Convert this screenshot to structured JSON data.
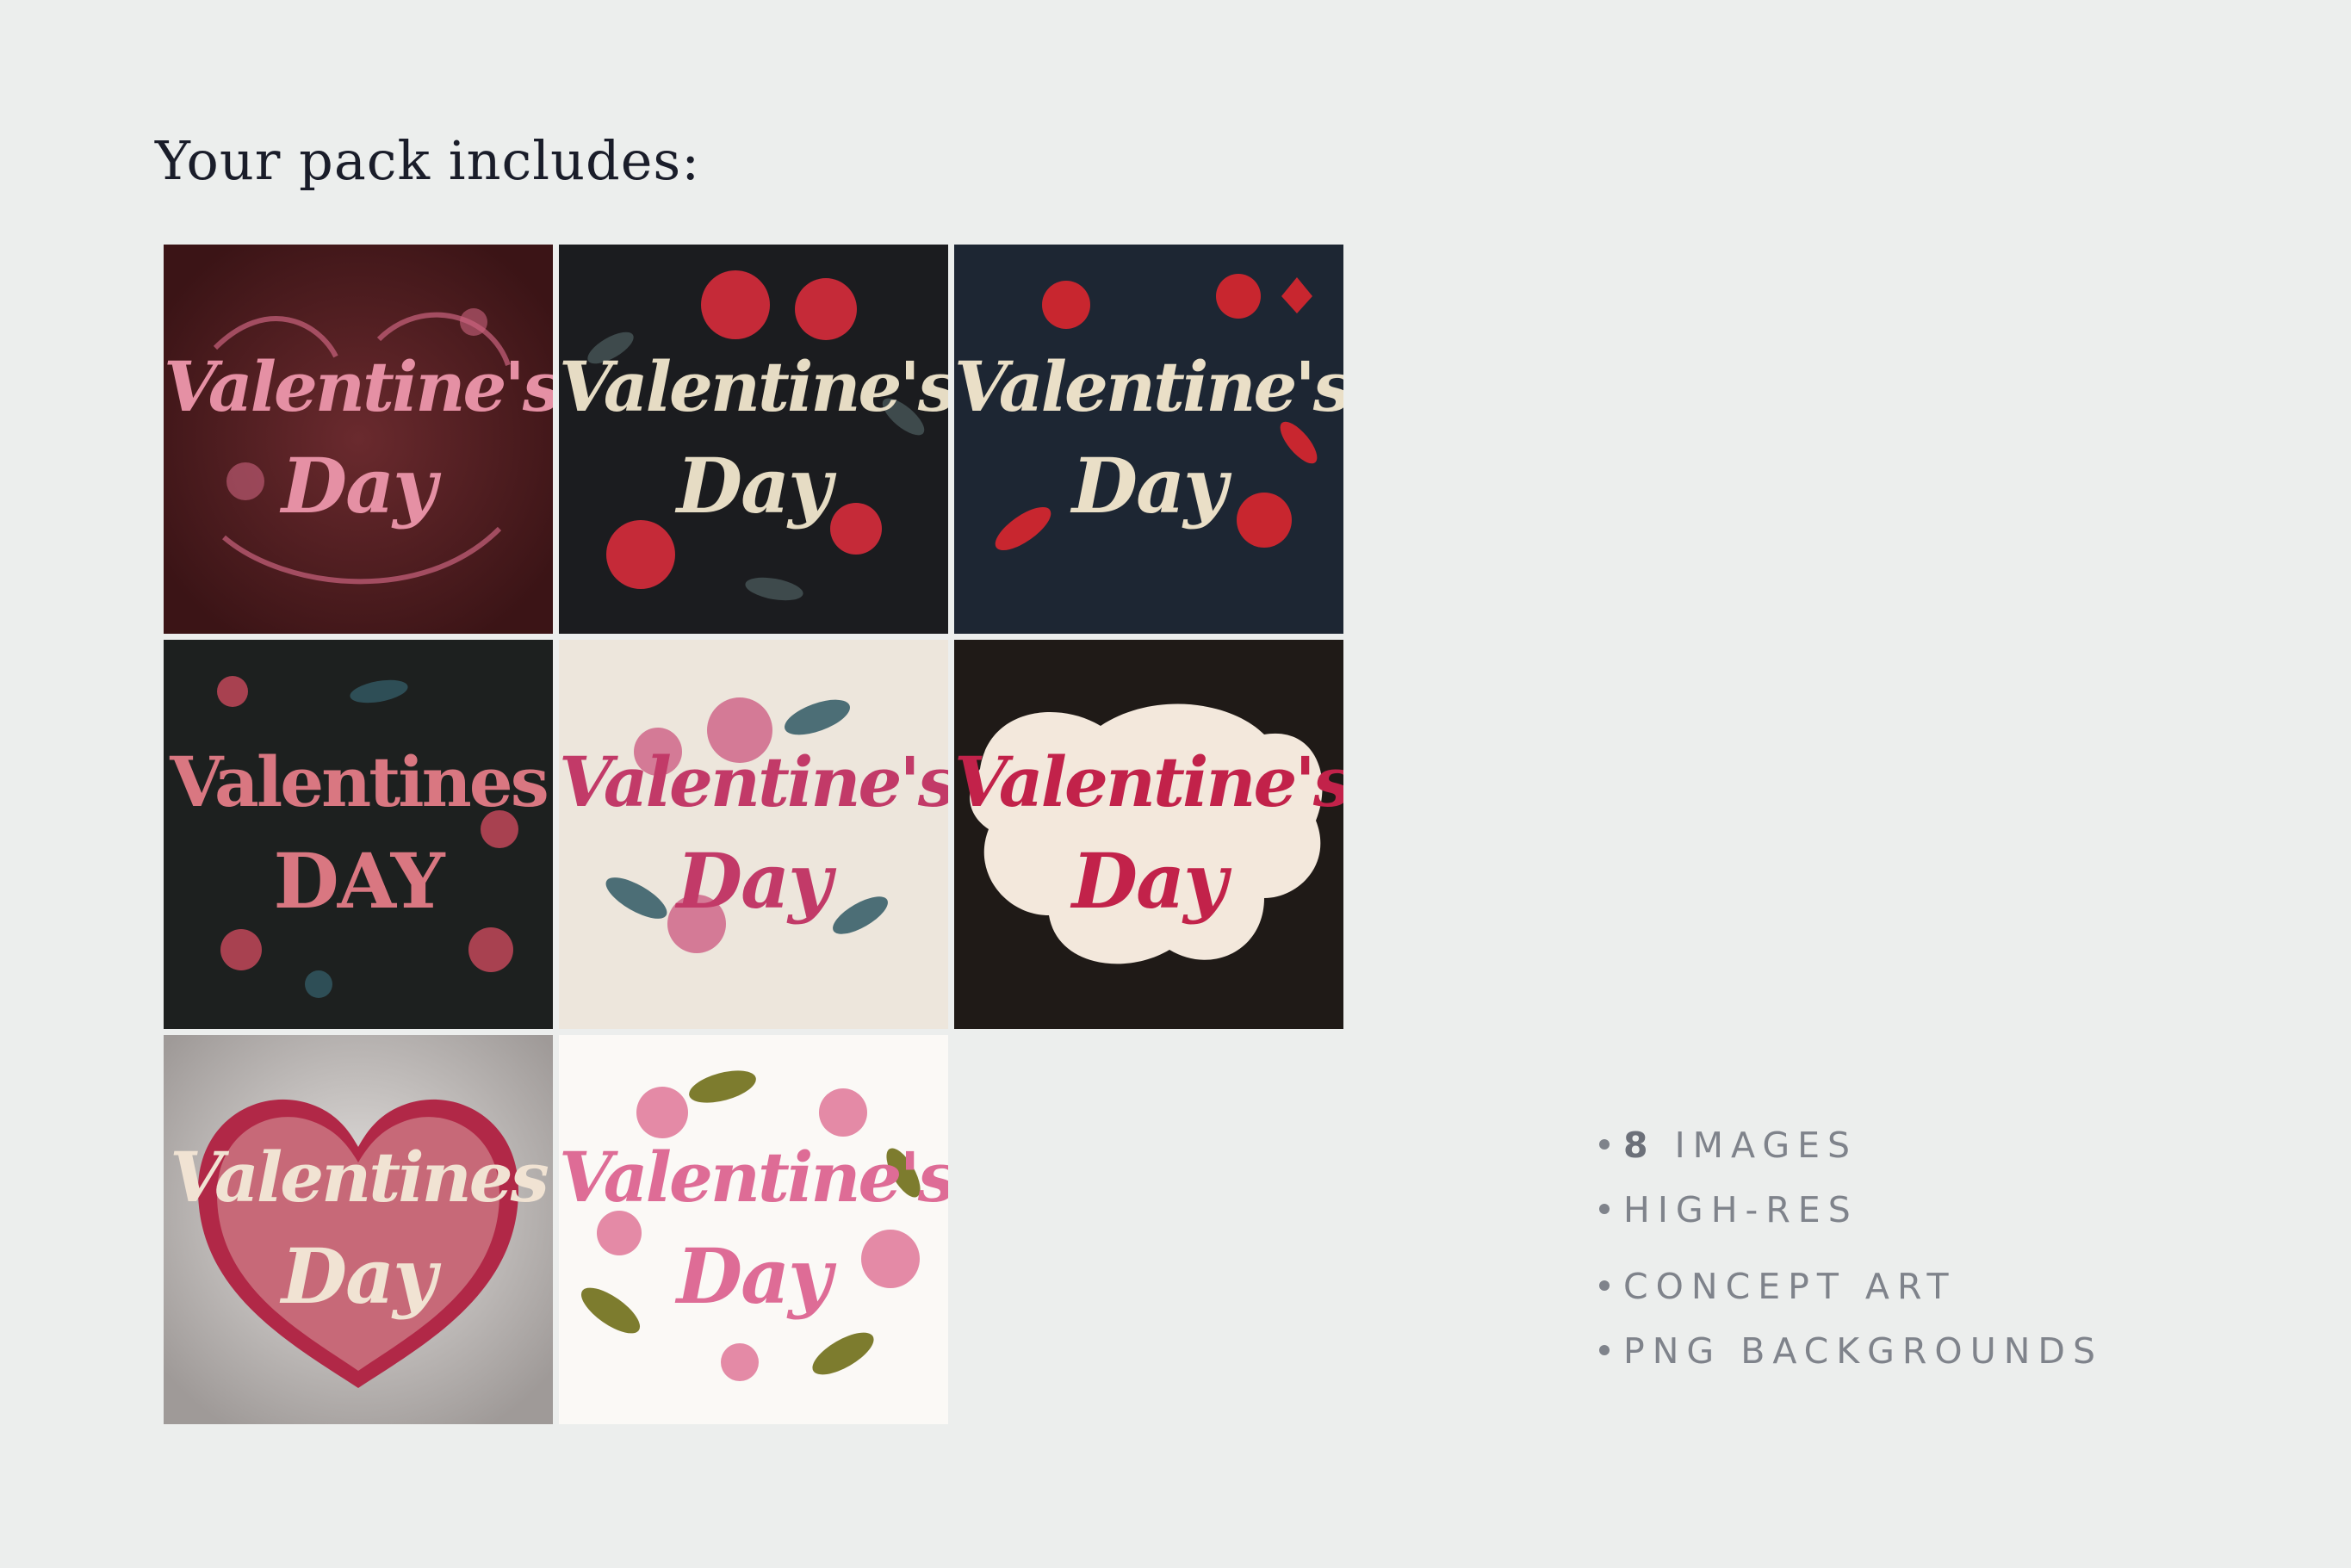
{
  "title": "Your pack includes:",
  "tiles": [
    {
      "line1": "Valentine's",
      "line2": "Day",
      "bg": "#4e1c1f",
      "text": "#e590a4",
      "accent": "#c9637d"
    },
    {
      "line1": "Valentine's",
      "line2": "Day",
      "bg": "#1b1c1f",
      "text": "#e6dcc4",
      "accent": "#c52a38"
    },
    {
      "line1": "Valentine's",
      "line2": "Day",
      "bg": "#1d2633",
      "text": "#eadfc7",
      "accent": "#c8262f"
    },
    {
      "line1": "Valentines",
      "line2": "DAY",
      "bg": "#1d201f",
      "text": "#d97781",
      "accent": "#a84150"
    },
    {
      "line1": "Valentine's",
      "line2": "Day",
      "bg": "#ede6dc",
      "text": "#c23a68",
      "accent": "#4c6e76"
    },
    {
      "line1": "Valentine's",
      "line2": "Day",
      "bg": "#1f1a17",
      "text": "#c2224a",
      "accent": "#f3e8dc"
    },
    {
      "line1": "Valentines",
      "line2": "Day",
      "bg": "#c8c4c2",
      "text": "#b12847",
      "accent": "#f1e3d3"
    },
    {
      "line1": "Valentine's",
      "line2": "Day",
      "bg": "#fbf9f6",
      "text": "#de6c96",
      "accent": "#7d7c2e"
    }
  ],
  "features": [
    {
      "number": "8",
      "label": "IMAGES"
    },
    {
      "number": "",
      "label": "HIGH-RES"
    },
    {
      "number": "",
      "label": "CONCEPT ART"
    },
    {
      "number": "",
      "label": "PNG BACKGROUNDS"
    }
  ]
}
